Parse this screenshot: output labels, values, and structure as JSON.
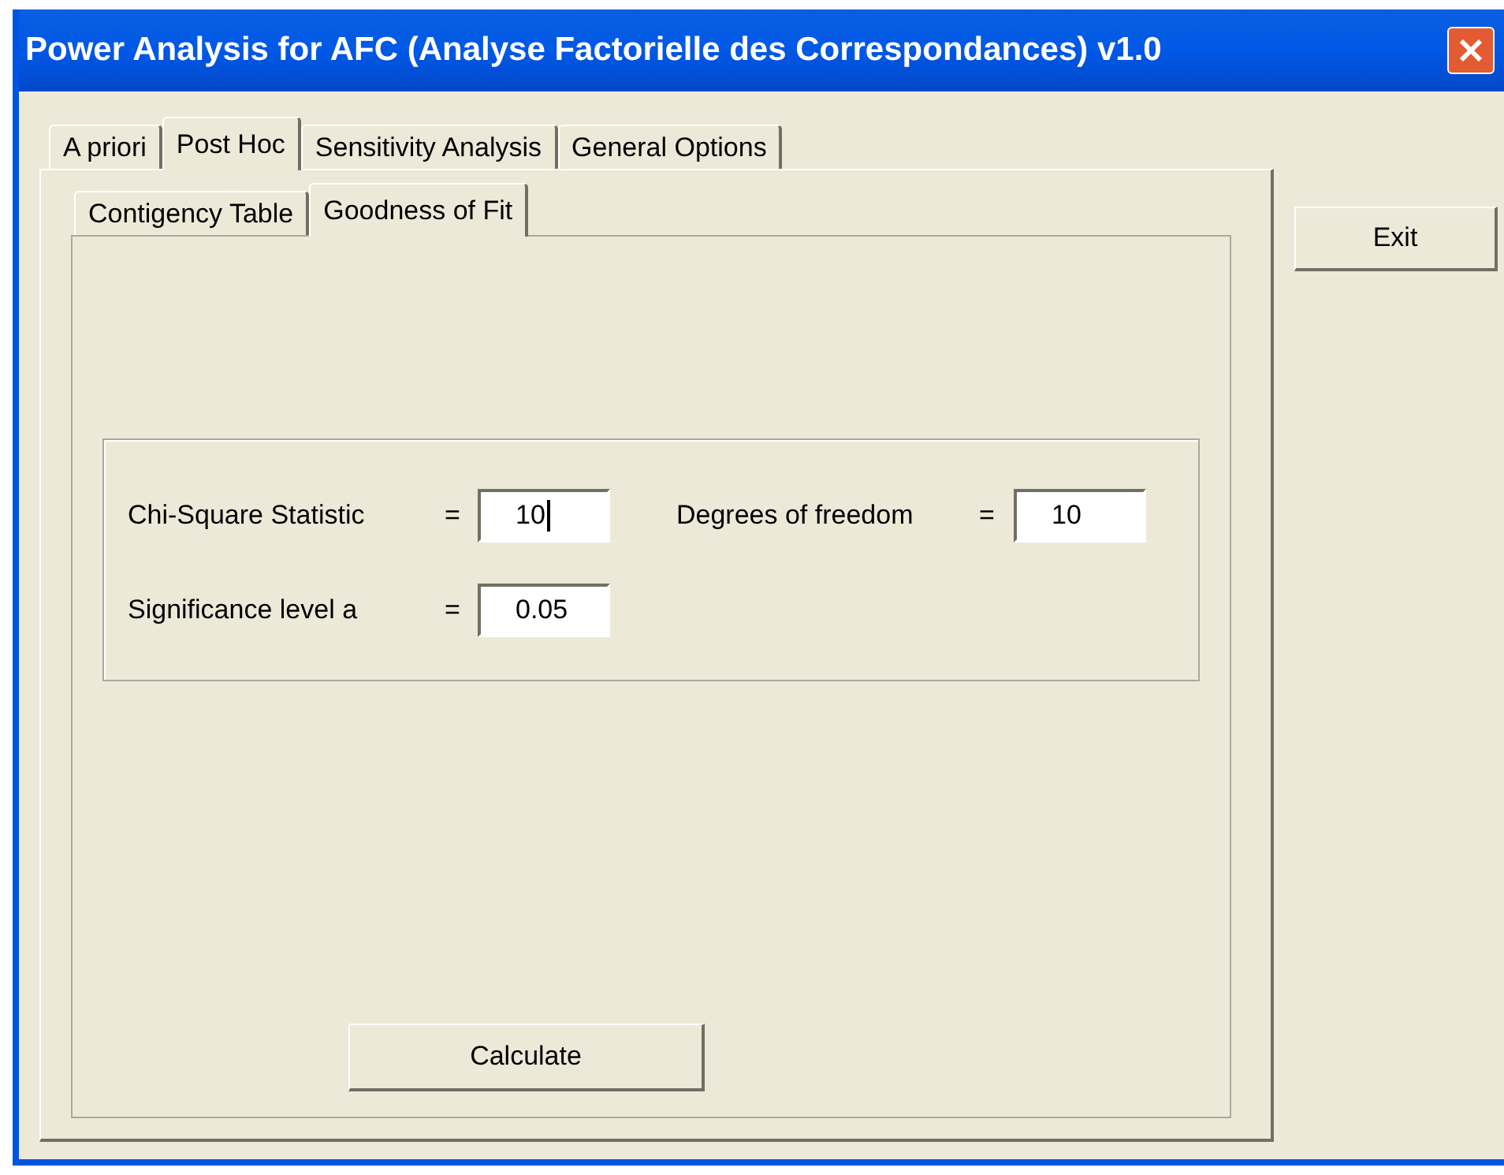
{
  "window": {
    "title": "Power Analysis for AFC (Analyse Factorielle des Correspondances) v1.0"
  },
  "tabs": [
    {
      "label": "A priori",
      "selected": false
    },
    {
      "label": "Post Hoc",
      "selected": true
    },
    {
      "label": "Sensitivity Analysis",
      "selected": false
    },
    {
      "label": "General Options",
      "selected": false
    }
  ],
  "subtabs": [
    {
      "label": "Contigency Table",
      "selected": false
    },
    {
      "label": "Goodness of Fit",
      "selected": true
    }
  ],
  "fields": [
    {
      "label": "Chi-Square Statistic",
      "equals": "=",
      "value": "10",
      "focused": true
    },
    {
      "label": "Degrees of freedom",
      "equals": "=",
      "value": "10",
      "focused": false
    },
    {
      "label": "Significance level a",
      "equals": "=",
      "value": "0.05",
      "focused": false
    }
  ],
  "calculate_button": "Calculate",
  "exit_button": "Exit"
}
